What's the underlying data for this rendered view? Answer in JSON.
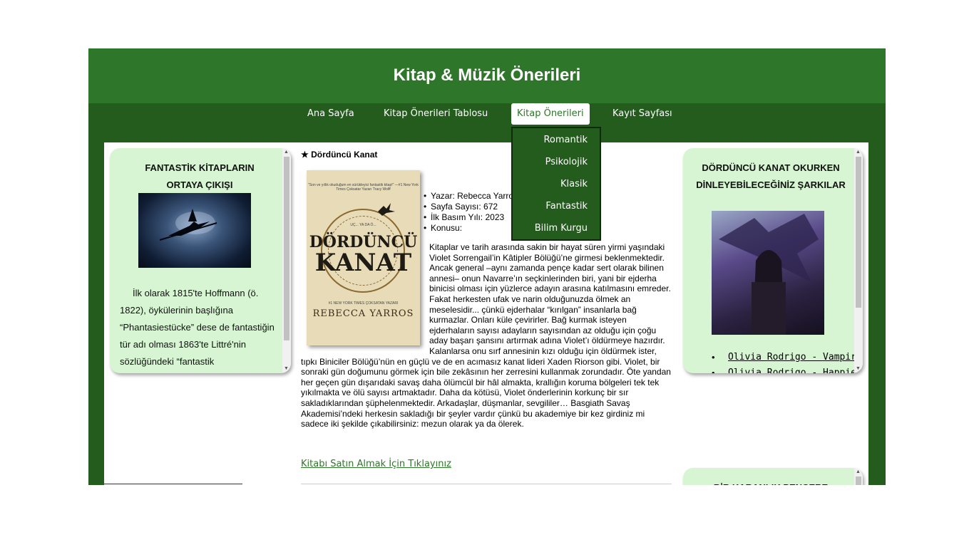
{
  "header": {
    "title": "Kitap & Müzik Önerileri"
  },
  "nav": {
    "items": [
      {
        "label": "Ana Sayfa"
      },
      {
        "label": "Kitap Önerileri Tablosu"
      },
      {
        "label": "Kitap Önerileri"
      },
      {
        "label": "Kayıt Sayfası"
      }
    ],
    "active": "Kitap Önerileri",
    "dropdown": [
      "Romantik",
      "Psikolojik",
      "Klasik",
      "Fantastik",
      "Bilim Kurgu"
    ]
  },
  "left_panel": {
    "title_line1": "FANTASTİK KİTAPLARIN",
    "title_line2": "ORTAYA ÇIKIŞI",
    "text": "İlk olarak 1815'te Hoffmann (ö. 1822), öykülerinin başlığına “Phantasiestücke” dese de fantastiğin tür adı olması 1863'te Littré'nin sözlüğündeki “fantastik"
  },
  "main": {
    "book_title": "★ Dördüncü Kanat",
    "cover": {
      "quote": "\"Son ve yıllık okuduğum en sürükleyici fantastik kitap!\" —#1 New York Times Çoksatar Yazarı Tracy Wolff",
      "series": "UÇ... YA DA Ö...",
      "title_line1": "DÖRDÜNCÜ",
      "title_line2": "KANAT",
      "tagline": "#1 NEW YORK TIMES ÇOKSATAN YAZARI",
      "author": "REBECCA YARROS"
    },
    "meta": [
      "Yazar: Rebecca Yarros",
      "Sayfa Sayısı: 672",
      "İlk Basım Yılı: 2023",
      "Konusu:"
    ],
    "summary": "Kitaplar ve tarih arasında sakin bir hayat süren yirmi yaşındaki Violet Sorrengail’in Kâtipler Bölüğü’ne girmesi beklenmektedir. Ancak general –aynı zamanda pençe kadar sert olarak bilinen annesi– onun Navarre’ın seçkinlerinden biri, yani bir ejderha binicisi olması için yüzlerce adayın arasına katılmasını emreder. Fakat herkesten ufak ve narin olduğunuzda ölmek an meselesidir... çünkü ejderhalar “kırılgan” insanlarla bağ kurmazlar. Onları küle çevirirler. Bağ kurmak isteyen ejderhaların sayısı adayların sayısından az olduğu için çoğu aday başarı şansını artırmak adına Violet’ı öldürmeye hazırdır. Kalanlarsa onu sırf annesinin kızı olduğu için öldürmek ister, tıpkı Biniciler Bölüğü’nün en güçlü ve de en acımasız kanat lideri Xaden Riorson gibi. Violet, bir sonraki gün doğumunu görmek için bile zekâsının her zerresini kullanmak zorundadır. Öte yandan her geçen gün dışarıdaki savaş daha ölümcül bir hâl almakta, krallığın koruma bölgeleri tek tek yıkılmakta ve ölü sayısı artmaktadır. Daha da kötüsü, Violet önderlerinin korkunç bir sır sakladıklarından şüphelenmektedir. Arkadaşlar, düşmanlar, sevgililer… Basgiath Savaş Akademisi’ndeki herkesin sakladığı bir şeyler vardır çünkü bu akademiye bir kez girdiniz mi sadece iki şekilde çıkabilirsiniz: mezun olarak ya da ölerek.",
    "buy_link": "Kitabı Satın Almak İçin Tıklayınız"
  },
  "right_panel": {
    "title_line1": "DÖRDÜNCÜ KANAT OKURKEN",
    "title_line2": "DİNLEYEBİLECEĞİNİZ ŞARKILAR",
    "songs": [
      "Olivia Rodrigo - Vampire",
      "Olivia Rodrigo - Happier"
    ]
  },
  "right_panel_2": {
    "title": "BİR KARANLIK PENCERE"
  },
  "colors": {
    "frame": "#245c1e",
    "header": "#2e7629",
    "panel": "#d7f5d3",
    "link": "#2e7629"
  }
}
